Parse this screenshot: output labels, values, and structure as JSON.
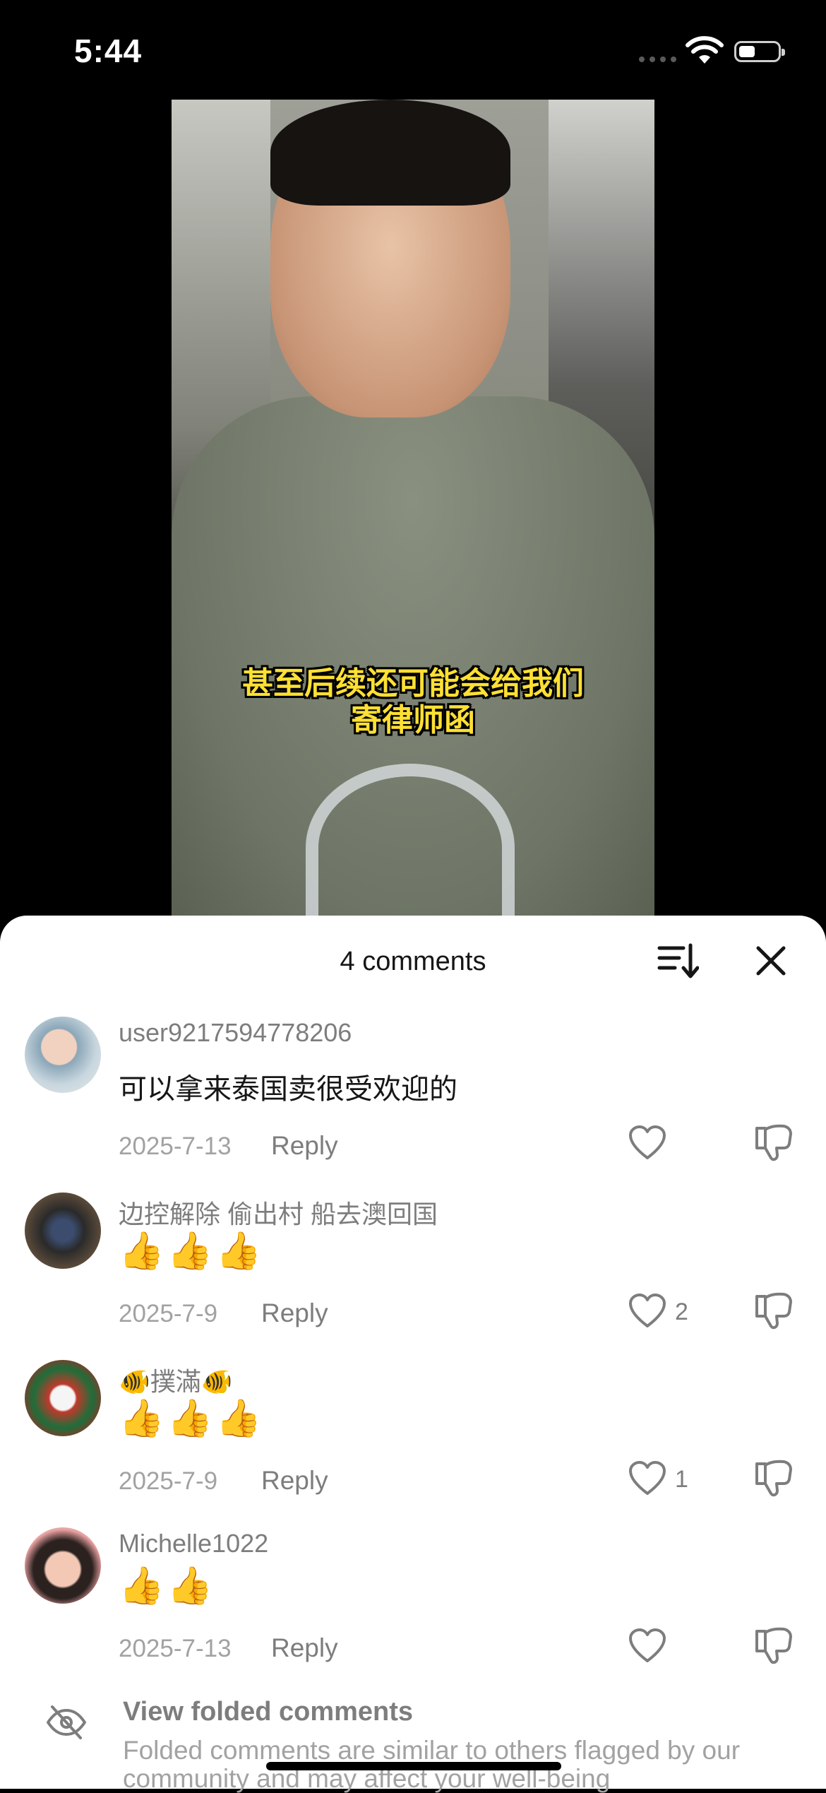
{
  "status": {
    "time": "5:44"
  },
  "video": {
    "subtitle_line1": "甚至后续还可能会给我们",
    "subtitle_line2": "寄律师函"
  },
  "comments_panel": {
    "title": "4 comments",
    "sort_icon": "sort-icon",
    "close_icon": "close-icon",
    "comments": [
      {
        "username": "user9217594778206",
        "text": "可以拿来泰国卖很受欢迎的",
        "date": "2025-7-13",
        "reply": "Reply",
        "likes": ""
      },
      {
        "username": "边控解除 偷出村 船去澳回国",
        "text": "👍👍👍",
        "date": "2025-7-9",
        "reply": "Reply",
        "likes": "2"
      },
      {
        "username": "🐠撲滿🐠",
        "text": "👍👍👍",
        "date": "2025-7-9",
        "reply": "Reply",
        "likes": "1"
      },
      {
        "username": "Michelle1022",
        "text": "👍👍",
        "date": "2025-7-13",
        "reply": "Reply",
        "likes": ""
      }
    ],
    "folded": {
      "title": "View folded comments",
      "description": "Folded comments are similar to others flagged by our community and may affect your well-being"
    }
  }
}
